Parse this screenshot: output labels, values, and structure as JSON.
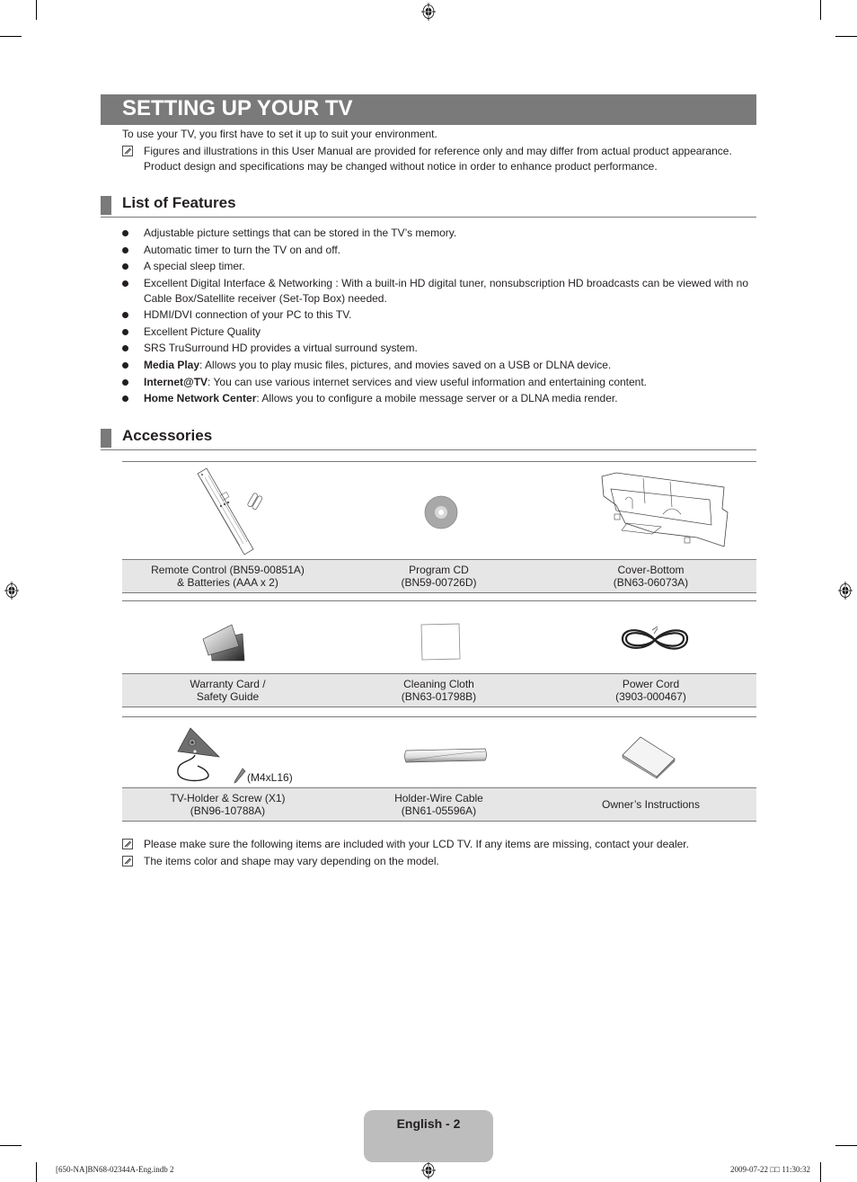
{
  "page": {
    "title": "SETTING UP YOUR TV",
    "intro": "To use your TV, you first have to set it up to suit your environment.",
    "intro_note": "Figures and illustrations in this User Manual are provided for reference only and may differ from actual product appearance. Product design and specifications may be changed without notice in order to enhance product performance."
  },
  "features": {
    "heading": "List of Features",
    "items": [
      {
        "bold": "",
        "text": "Adjustable picture settings that can be stored in the TV’s memory."
      },
      {
        "bold": "",
        "text": "Automatic timer to turn the TV on and off."
      },
      {
        "bold": "",
        "text": "A special sleep timer."
      },
      {
        "bold": "",
        "text": "Excellent Digital Interface & Networking : With a built-in HD digital tuner, nonsubscription HD broadcasts can be viewed with no Cable Box/Satellite receiver (Set-Top Box) needed."
      },
      {
        "bold": "",
        "text": "HDMI/DVI connection of your PC to this TV."
      },
      {
        "bold": "",
        "text": "Excellent Picture Quality"
      },
      {
        "bold": "",
        "text": "SRS TruSurround HD provides a virtual surround system."
      },
      {
        "bold": "Media Play",
        "text": ": Allows you to play music files, pictures, and movies saved on a USB or DLNA device."
      },
      {
        "bold": "Internet@TV",
        "text": ": You can use various internet services and view useful information and entertaining content."
      },
      {
        "bold": "Home Network Center",
        "text": ": Allows you to configure a mobile message server or a DLNA media render."
      }
    ]
  },
  "accessories": {
    "heading": "Accessories",
    "rows": [
      [
        {
          "line1": "Remote Control (BN59-00851A)",
          "line2": "& Batteries (AAA x 2)",
          "icon": "remote-control-icon"
        },
        {
          "line1": "Program CD",
          "line2": "(BN59-00726D)",
          "icon": "cd-icon"
        },
        {
          "line1": "Cover-Bottom",
          "line2": "(BN63-06073A)",
          "icon": "cover-bottom-icon"
        }
      ],
      [
        {
          "line1": "Warranty Card /",
          "line2": "Safety Guide",
          "icon": "warranty-card-icon"
        },
        {
          "line1": "Cleaning Cloth",
          "line2": "(BN63-01798B)",
          "icon": "cleaning-cloth-icon"
        },
        {
          "line1": "Power Cord",
          "line2": "(3903-000467)",
          "icon": "power-cord-icon"
        }
      ],
      [
        {
          "line1": "TV-Holder & Screw (X1)",
          "line2": "(BN96-10788A)",
          "icon": "tv-holder-icon",
          "extra": "(M4xL16)"
        },
        {
          "line1": "Holder-Wire Cable",
          "line2": "(BN61-05596A)",
          "icon": "holder-wire-cable-icon"
        },
        {
          "line1": "Owner’s Instructions",
          "line2": "",
          "icon": "owners-instructions-icon"
        }
      ]
    ],
    "notes": [
      "Please make sure the following items are included with your LCD TV. If any items are missing, contact your dealer.",
      "The items color and shape may vary depending on the model."
    ]
  },
  "footer": {
    "page_label": "English - 2",
    "slug_left": "[650-NA]BN68-02344A-Eng.indb   2",
    "slug_right": "2009-07-22   □□ 11:30:32"
  },
  "colors": {
    "title_bar": "#7a7a7a",
    "caption_bg": "#e6e6e6",
    "footer_tab": "#bdbdbd"
  }
}
